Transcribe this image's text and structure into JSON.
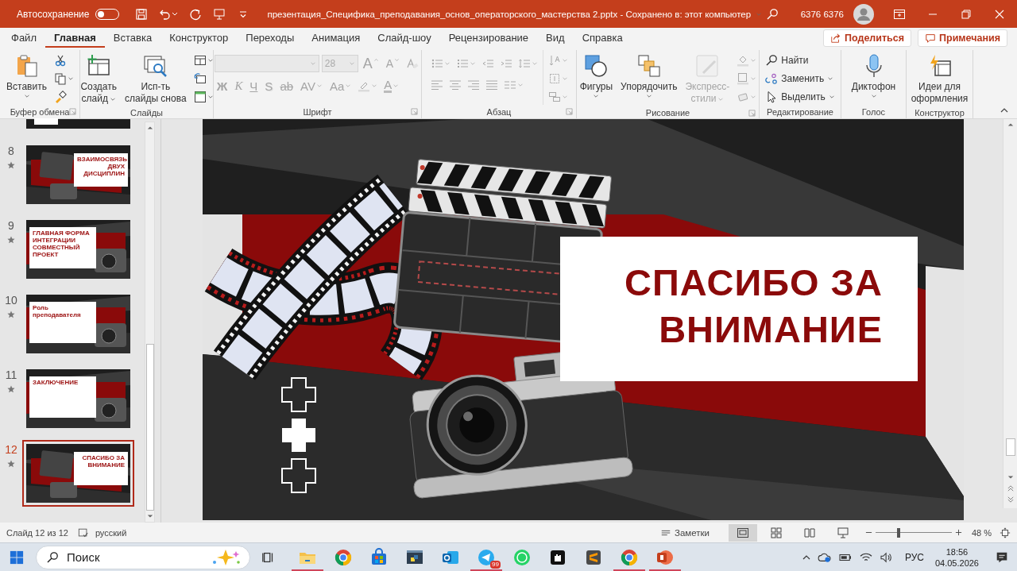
{
  "title_bar": {
    "autosave_label": "Автосохранение",
    "autosave_on": false,
    "document_title": "презентация_Специфика_преподавания_основ_операторского_мастерства 2.pptx  -  Сохранено в: этот компьютер",
    "user_name": "6376 6376"
  },
  "ribbon": {
    "tabs": [
      {
        "label": "Файл",
        "selected": false
      },
      {
        "label": "Главная",
        "selected": true
      },
      {
        "label": "Вставка",
        "selected": false
      },
      {
        "label": "Конструктор",
        "selected": false
      },
      {
        "label": "Переходы",
        "selected": false
      },
      {
        "label": "Анимация",
        "selected": false
      },
      {
        "label": "Слайд-шоу",
        "selected": false
      },
      {
        "label": "Рецензирование",
        "selected": false
      },
      {
        "label": "Вид",
        "selected": false
      },
      {
        "label": "Справка",
        "selected": false
      }
    ],
    "share_label": "Поделиться",
    "comments_label": "Примечания",
    "groups": [
      {
        "label": "Буфер обмена",
        "launcher": true,
        "kind": "columns",
        "columns": [
          [
            {
              "kind": "large",
              "label_lines": [
                "Вставить"
              ],
              "dropdown": true,
              "disabled": false
            }
          ],
          [
            {
              "kind": "icon",
              "dropdown": false,
              "disabled": false
            },
            {
              "kind": "icon",
              "dropdown": true,
              "disabled": false
            },
            {
              "kind": "icon",
              "dropdown": false,
              "disabled": false
            }
          ]
        ]
      },
      {
        "label": "Слайды",
        "launcher": false,
        "kind": "columns",
        "columns": [
          [
            {
              "kind": "large",
              "label_lines": [
                "Создать",
                "слайд"
              ],
              "dropdown": true,
              "disabled": false
            }
          ],
          [
            {
              "kind": "large",
              "label_lines": [
                "Исп-ть",
                "слайды снова"
              ],
              "dropdown": false,
              "disabled": false
            }
          ],
          [
            {
              "kind": "icon",
              "dropdown": true,
              "disabled": false
            },
            {
              "kind": "icon",
              "dropdown": false,
              "disabled": false
            },
            {
              "kind": "icon",
              "dropdown": true,
              "disabled": false
            }
          ]
        ]
      },
      {
        "label": "Шрифт",
        "launcher": true,
        "kind": "rows",
        "upper": [
          {
            "kind": "combo",
            "disabled": true
          },
          {
            "kind": "combo",
            "value": "28",
            "disabled": true
          },
          {
            "kind": "glyph",
            "text": "A",
            "dropdown": false,
            "disabled": true
          },
          {
            "kind": "glyph",
            "text": "A",
            "dropdown": false,
            "disabled": true
          },
          {
            "kind": "icon",
            "dropdown": false,
            "disabled": true
          }
        ],
        "lower": [
          {
            "kind": "glyph",
            "text": "Ж",
            "dropdown": false,
            "disabled": true
          },
          {
            "kind": "glyph",
            "text": "К",
            "dropdown": false,
            "disabled": true
          },
          {
            "kind": "glyph",
            "text": "Ч",
            "dropdown": false,
            "disabled": true
          },
          {
            "kind": "glyph",
            "text": "S",
            "dropdown": false,
            "disabled": true
          },
          {
            "kind": "glyph",
            "text": "ab",
            "dropdown": false,
            "disabled": true
          },
          {
            "kind": "glyph",
            "text": "AV",
            "dropdown": true,
            "disabled": true
          },
          {
            "kind": "glyph",
            "text": "Aa",
            "dropdown": true,
            "disabled": true
          },
          {
            "kind": "icon",
            "dropdown": true,
            "disabled": true
          },
          {
            "kind": "glyph",
            "text": "A",
            "dropdown": true,
            "disabled": true
          }
        ]
      },
      {
        "label": "Абзац",
        "launcher": true,
        "kind": "rows",
        "upper": [
          {
            "kind": "icon",
            "dropdown": true,
            "disabled": true
          },
          {
            "kind": "icon",
            "dropdown": true,
            "disabled": true
          },
          {
            "kind": "icon",
            "dropdown": false,
            "disabled": true
          },
          {
            "kind": "icon",
            "dropdown": false,
            "disabled": true
          },
          {
            "kind": "icon",
            "dropdown": true,
            "disabled": true
          }
        ],
        "lower": [
          {
            "kind": "icon",
            "dropdown": false,
            "disabled": true
          },
          {
            "kind": "icon",
            "dropdown": false,
            "disabled": true
          },
          {
            "kind": "icon",
            "dropdown": false,
            "disabled": true
          },
          {
            "kind": "icon",
            "dropdown": false,
            "disabled": true
          },
          {
            "kind": "icon",
            "dropdown": true,
            "disabled": true
          }
        ],
        "side": [
          {
            "kind": "icon",
            "dropdown": true,
            "disabled": true
          },
          {
            "kind": "icon",
            "dropdown": true,
            "disabled": true
          },
          {
            "kind": "icon",
            "dropdown": true,
            "disabled": true
          }
        ]
      },
      {
        "label": "Рисование",
        "launcher": true,
        "kind": "columns",
        "columns": [
          [
            {
              "kind": "large",
              "label_lines": [
                "Фигуры"
              ],
              "dropdown": true,
              "disabled": false
            }
          ],
          [
            {
              "kind": "large",
              "label_lines": [
                "Упорядочить"
              ],
              "dropdown": true,
              "disabled": false
            }
          ],
          [
            {
              "kind": "large",
              "label_lines": [
                "Экспресс-",
                "стили"
              ],
              "dropdown": true,
              "disabled": true
            }
          ],
          [
            {
              "kind": "icon",
              "dropdown": true,
              "disabled": true
            },
            {
              "kind": "icon",
              "dropdown": true,
              "disabled": true
            },
            {
              "kind": "icon",
              "dropdown": true,
              "disabled": true
            }
          ]
        ]
      },
      {
        "label": "Редактирование",
        "launcher": false,
        "kind": "columns",
        "columns": [
          [
            {
              "kind": "row",
              "label": "Найти",
              "dropdown": false,
              "disabled": false
            },
            {
              "kind": "row",
              "label": "Заменить",
              "dropdown": true,
              "disabled": false
            },
            {
              "kind": "row",
              "label": "Выделить",
              "dropdown": true,
              "disabled": false
            }
          ]
        ]
      },
      {
        "label": "Голос",
        "launcher": false,
        "kind": "columns",
        "columns": [
          [
            {
              "kind": "large",
              "label_lines": [
                "Диктофон"
              ],
              "dropdown": true,
              "disabled": false
            }
          ]
        ]
      },
      {
        "label": "Конструктор",
        "launcher": false,
        "kind": "columns",
        "columns": [
          [
            {
              "kind": "large",
              "label_lines": [
                "Идеи для",
                "оформления"
              ],
              "dropdown": false,
              "disabled": false
            }
          ]
        ]
      }
    ]
  },
  "thumbnails": [
    {
      "number": "8",
      "title": "ВЗАИМОСВЯЗЬ ДВУХ ДИСЦИПЛИН",
      "kind": "card-right",
      "selected": false
    },
    {
      "number": "9",
      "title": "ГЛАВНАЯ ФОРМА ИНТЕГРАЦИИ СОВМЕСТНЫЙ ПРОЕКТ",
      "kind": "card-left",
      "selected": false
    },
    {
      "number": "10",
      "title": "Роль преподавателя",
      "kind": "card-left",
      "selected": false
    },
    {
      "number": "11",
      "title": "ЗАКЛЮЧЕНИЕ",
      "kind": "card-left",
      "selected": false
    },
    {
      "number": "12",
      "title": "СПАСИБО ЗА ВНИМАНИЕ",
      "kind": "card-right",
      "selected": true
    }
  ],
  "slide": {
    "title": "СПАСИБО ЗА ВНИМАНИЕ"
  },
  "status_bar": {
    "slide_counter": "Слайд 12 из 12",
    "language": "русский",
    "notes_label": "Заметки",
    "views": [
      {
        "selected": true
      },
      {
        "selected": false
      },
      {
        "selected": false
      },
      {
        "selected": false
      }
    ],
    "zoom": {
      "level": 0.3,
      "reading": "48 %"
    }
  },
  "taskbar": {
    "search_placeholder": "Поиск",
    "apps": [
      {
        "open": true
      },
      {
        "open": false
      },
      {
        "open": false
      },
      {
        "open": false
      },
      {
        "open": false
      },
      {
        "open": true,
        "badge": "99"
      },
      {
        "open": false
      },
      {
        "open": false
      },
      {
        "open": false
      },
      {
        "open": true
      },
      {
        "open": true
      }
    ],
    "language": "РУС",
    "time": "18:56",
    "date": "04.05.2026"
  }
}
